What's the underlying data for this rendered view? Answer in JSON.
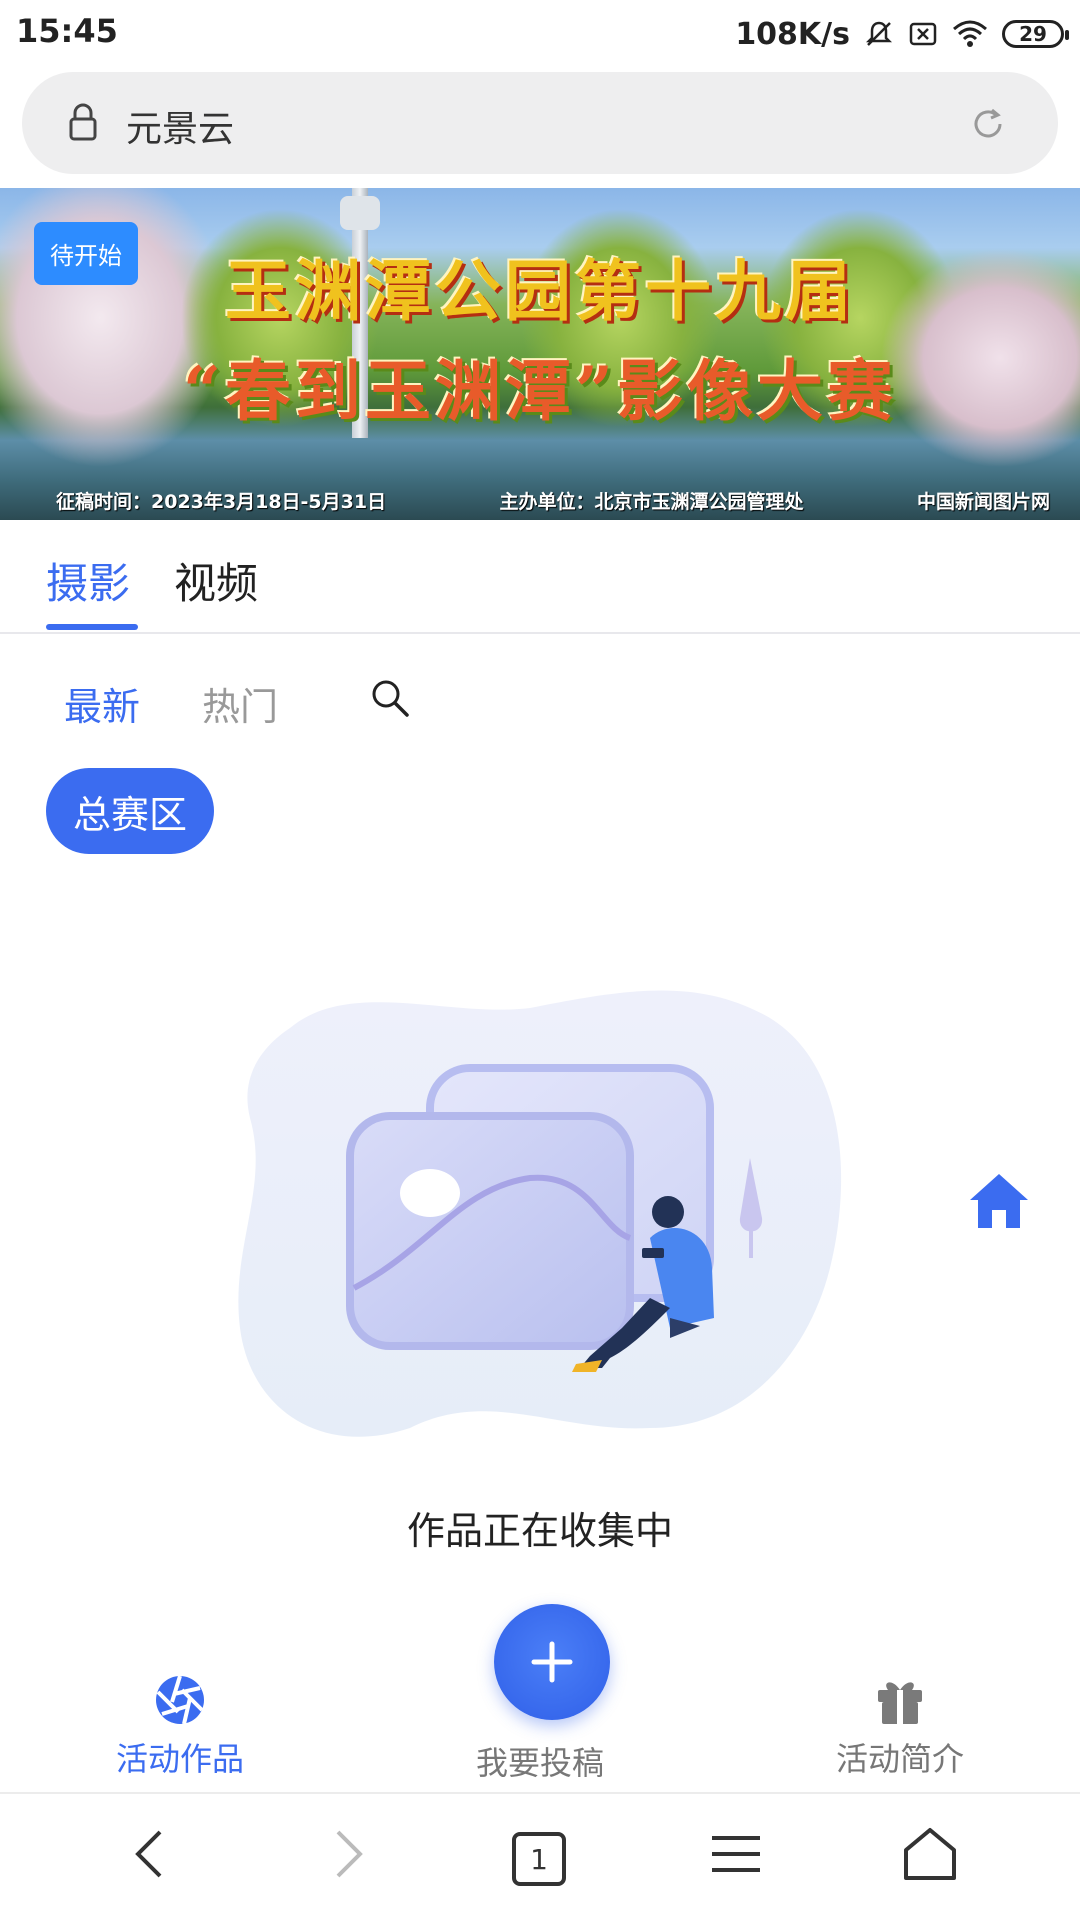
{
  "status_bar": {
    "time": "15:45",
    "net_speed": "108K/s",
    "battery": "29",
    "icons": [
      "mute-icon",
      "sim-off-icon",
      "wifi-icon",
      "battery-icon"
    ]
  },
  "address_bar": {
    "title": "元景云",
    "icons": [
      "lock-icon",
      "reload-icon"
    ]
  },
  "banner": {
    "status_tag": "待开始",
    "title_line1": "玉渊潭公园第十九届",
    "title_line2": "“春到玉渊潭”影像大赛",
    "footer_dates": "征稿时间：2023年3月18日-5月31日",
    "footer_host": "主办单位：北京市玉渊潭公园管理处",
    "footer_partner": "中国新闻图片网"
  },
  "main_tabs": [
    {
      "label": "摄影",
      "active": true
    },
    {
      "label": "视频",
      "active": false
    }
  ],
  "sub_tabs": [
    {
      "label": "最新",
      "active": true
    },
    {
      "label": "热门",
      "active": false
    }
  ],
  "zone_chip": "总赛区",
  "empty_state": {
    "message": "作品正在收集中"
  },
  "bottom_actions": {
    "works": "活动作品",
    "submit": "我要投稿",
    "intro": "活动简介"
  },
  "browser_nav": {
    "tab_count": "1"
  },
  "colors": {
    "accent": "#3b6cf0",
    "status_tag": "#2d8cff",
    "muted": "#777777"
  }
}
